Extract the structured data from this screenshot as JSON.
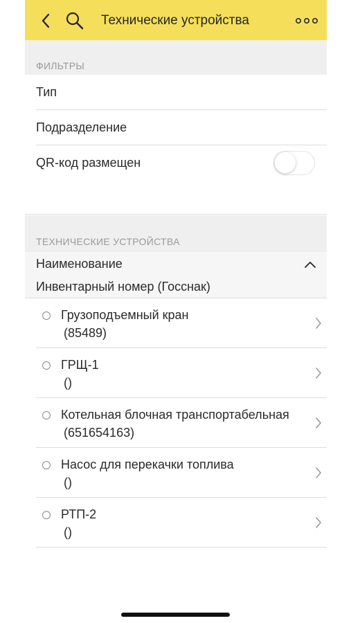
{
  "header": {
    "title": "Технические устройства",
    "background": "#f5df5a",
    "back_icon": "chevron-left-icon",
    "search_icon": "search-icon",
    "more_icon": "more-horizontal-icon"
  },
  "filters": {
    "section_label": "ФИЛЬТРЫ",
    "items": [
      {
        "label": "Тип"
      },
      {
        "label": "Подразделение"
      },
      {
        "label": "QR-код размещен",
        "toggle": false
      }
    ]
  },
  "devices": {
    "section_label": "ТЕХНИЧЕСКИЕ УСТРОЙСТВА",
    "sort_primary": "Наименование",
    "sort_secondary": "Инвентарный номер (Госснак)",
    "items": [
      {
        "name": "Грузоподъемный кран",
        "inventory": "(85489)"
      },
      {
        "name": "ГРЩ-1",
        "inventory": "()"
      },
      {
        "name": "Котельная блочная транспортабельная",
        "inventory": "(651654163)"
      },
      {
        "name": "Насос для перекачки топлива",
        "inventory": "()"
      },
      {
        "name": "РТП-2",
        "inventory": "()"
      }
    ]
  }
}
